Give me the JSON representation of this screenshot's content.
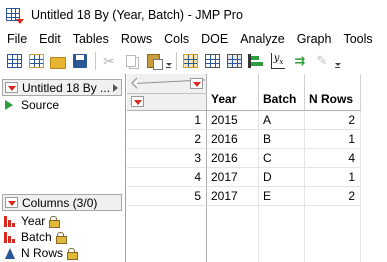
{
  "window": {
    "title": "Untitled 18 By (Year, Batch) - JMP Pro"
  },
  "menu": [
    "File",
    "Edit",
    "Tables",
    "Rows",
    "Cols",
    "DOE",
    "Analyze",
    "Graph",
    "Tools"
  ],
  "left_pane": {
    "table_name": "Untitled 18 By ...",
    "source_label": "Source",
    "columns_header": "Columns (3/0)",
    "columns": [
      {
        "name": "Year",
        "locked": true
      },
      {
        "name": "Batch",
        "locked": true
      },
      {
        "name": "N Rows",
        "locked": true
      }
    ]
  },
  "table": {
    "headers": [
      "Year",
      "Batch",
      "N Rows"
    ],
    "rows": [
      {
        "num": "1",
        "year": "2015",
        "batch": "A",
        "n": "2"
      },
      {
        "num": "2",
        "year": "2016",
        "batch": "B",
        "n": "1"
      },
      {
        "num": "3",
        "year": "2016",
        "batch": "C",
        "n": "4"
      },
      {
        "num": "4",
        "year": "2017",
        "batch": "D",
        "n": "1"
      },
      {
        "num": "5",
        "year": "2017",
        "batch": "E",
        "n": "2"
      }
    ]
  },
  "colors": {
    "accent_red": "#d9281e",
    "play_green": "#2e9e3a",
    "jmp_blue": "#2b5797"
  }
}
